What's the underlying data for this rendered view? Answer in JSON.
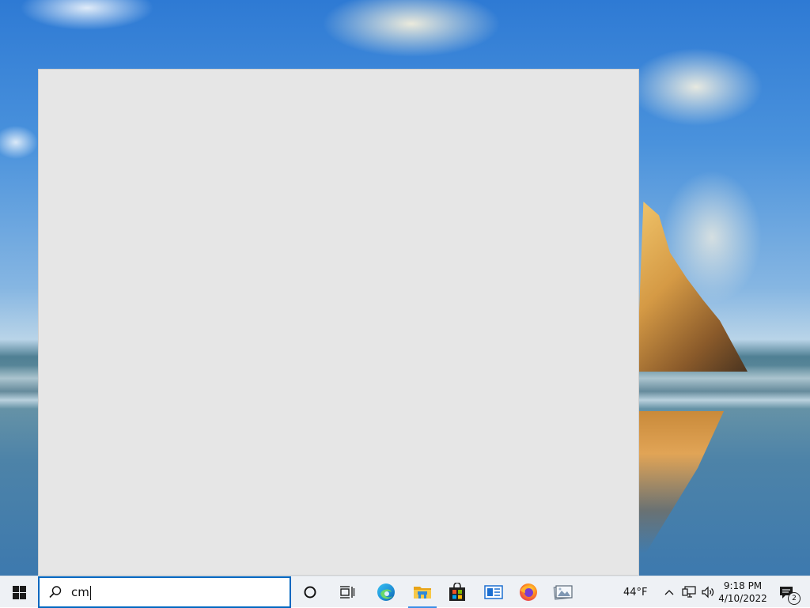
{
  "search": {
    "query": "cm"
  },
  "taskbar": {
    "pinned": [
      {
        "name": "Microsoft Edge",
        "icon": "edge-icon"
      },
      {
        "name": "File Explorer",
        "icon": "folder-icon",
        "active": true
      },
      {
        "name": "Microsoft Store",
        "icon": "store-icon"
      },
      {
        "name": "News",
        "icon": "news-icon"
      },
      {
        "name": "Firefox",
        "icon": "firefox-icon"
      },
      {
        "name": "Image Viewer",
        "icon": "image-viewer-icon"
      }
    ]
  },
  "tray": {
    "weather": "44°F",
    "time": "9:18 PM",
    "date": "4/10/2022",
    "notification_count": "2"
  },
  "colors": {
    "accent": "#0067c0",
    "taskbar": "#eef1f5",
    "search_panel": "#e6e6e6"
  }
}
